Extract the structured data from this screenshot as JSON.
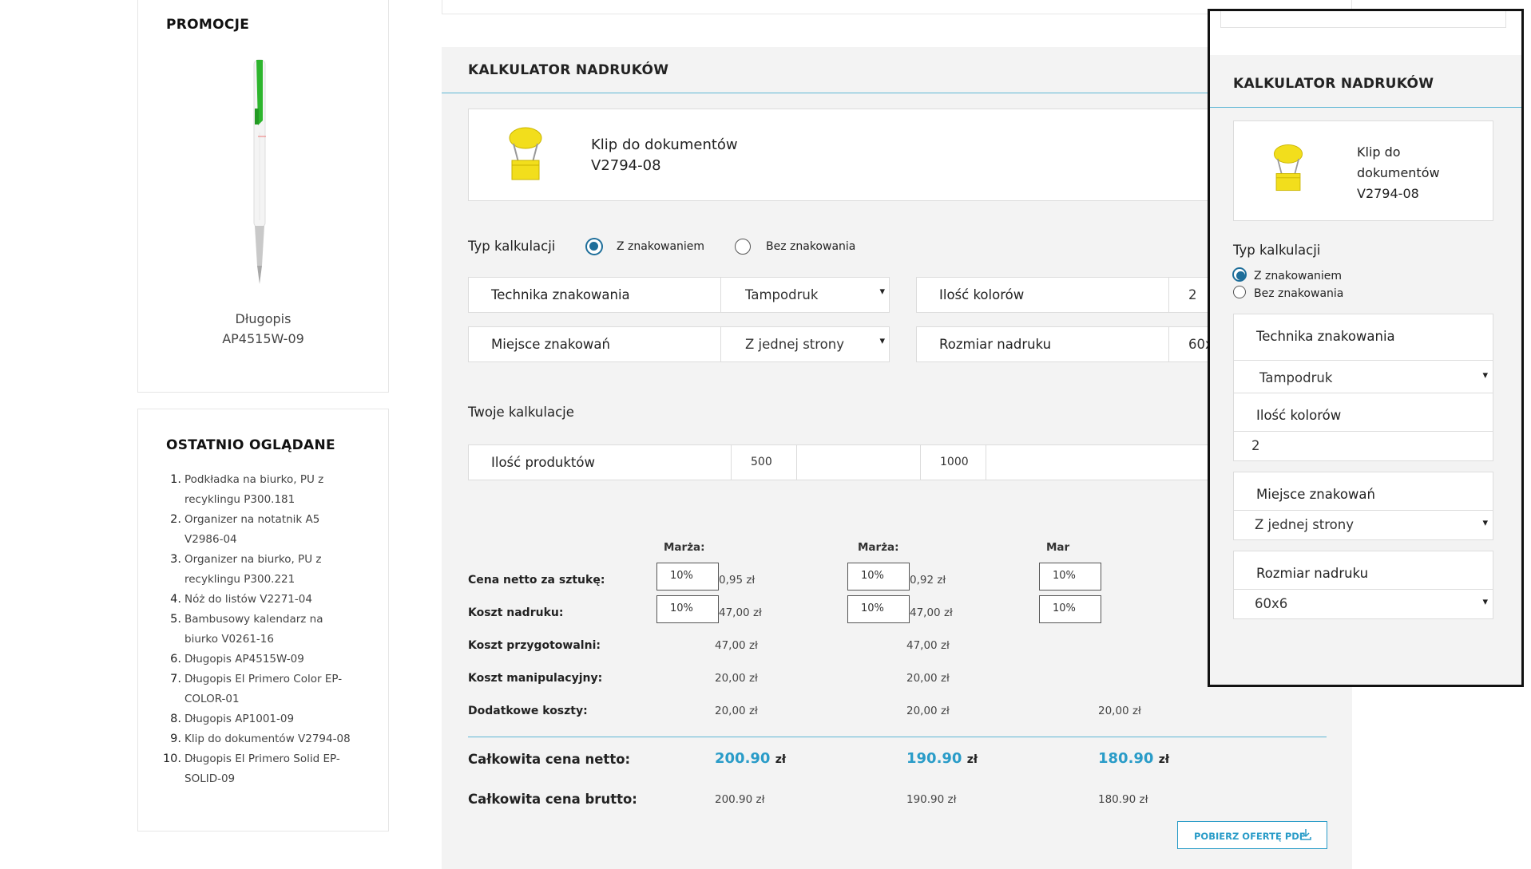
{
  "promo": {
    "title": "PROMOCJE",
    "product_name": "Długopis",
    "product_code": "AP4515W-09"
  },
  "recent": {
    "title": "OSTATNIO OGLĄDANE",
    "items": [
      {
        "num": "1.",
        "l1": "Podkładka na biurko, PU z",
        "l2": "recyklingu P300.181"
      },
      {
        "num": "2.",
        "l1": "Organizer na notatnik A5",
        "l2": "V2986-04"
      },
      {
        "num": "3.",
        "l1": "Organizer na biurko, PU z",
        "l2": "recyklingu P300.221"
      },
      {
        "num": "4.",
        "l1": "Nóż do listów V2271-04",
        "l2": ""
      },
      {
        "num": "5.",
        "l1": "Bambusowy kalendarz na",
        "l2": "biurko V0261-16"
      },
      {
        "num": "6.",
        "l1": "Długopis AP4515W-09",
        "l2": ""
      },
      {
        "num": "7.",
        "l1": "Długopis El Primero Color EP-",
        "l2": "COLOR-01"
      },
      {
        "num": "8.",
        "l1": "Długopis AP1001-09",
        "l2": ""
      },
      {
        "num": "9.",
        "l1": "Klip do dokumentów V2794-08",
        "l2": ""
      },
      {
        "num": "10.",
        "l1": "Długopis El Primero Solid EP-",
        "l2": "SOLID-09"
      }
    ]
  },
  "calc": {
    "title": "KALKULATOR NADRUKÓW",
    "product_name": "Klip do dokumentów",
    "product_code": "V2794-08",
    "typ_label": "Typ kalkulacji",
    "option_marked": "Z znakowaniem",
    "option_unmarked": "Bez znakowania",
    "selected_option": "Z znakowaniem",
    "technique_label": "Technika znakowania",
    "technique_value": "Tampodruk",
    "colors_label": "Ilość kolorów",
    "colors_value": "2",
    "place_label": "Miejsce znakowań",
    "place_value": "Z jednej strony",
    "size_label": "Rozmiar nadruku",
    "size_value_cut": "60x",
    "your_calcs": "Twoje kalkulacje",
    "qty_label": "Ilość produktów",
    "qty": [
      "500",
      "1000"
    ],
    "marza_label": "Marża:",
    "marza_label_cut": "Mar",
    "rows": {
      "unit_net": "Cena netto za sztukę:",
      "print_cost": "Koszt nadruku:",
      "prep_cost": "Koszt przygotowalni:",
      "handling_cost": "Koszt manipulacyjny:",
      "extra_cost": "Dodatkowe koszty:",
      "total_net": "Całkowita cena netto:",
      "total_gross": "Całkowita cena brutto:"
    },
    "columns": [
      {
        "unit_pct": "10%",
        "unit_net": "0,95 zł",
        "print_pct": "10%",
        "print_cost": "47,00 zł",
        "prep_cost": "47,00 zł",
        "handling_cost": "20,00 zł",
        "extra_cost": "20,00 zł",
        "total_net": "200.90",
        "total_gross": "200.90 zł"
      },
      {
        "unit_pct": "10%",
        "unit_net": "0,92 zł",
        "print_pct": "10%",
        "print_cost": "47,00 zł",
        "prep_cost": "47,00 zł",
        "handling_cost": "20,00 zł",
        "extra_cost": "20,00 zł",
        "total_net": "190.90",
        "total_gross": "190.90 zł"
      },
      {
        "unit_pct": "10%",
        "print_pct": "10%",
        "extra_cost": "20,00 zł",
        "total_net": "180.90",
        "total_gross": "180.90 zł"
      }
    ],
    "currency": "zł",
    "pdf_button": "POBIERZ OFERTĘ PDF"
  },
  "mobile": {
    "title": "KALKULATOR NADRUKÓW",
    "product_l1": "Klip do",
    "product_l2": "dokumentów",
    "product_code": "V2794-08",
    "typ_label": "Typ kalkulacji",
    "option_marked": "Z znakowaniem",
    "option_unmarked": "Bez znakowania",
    "technique_label": "Technika znakowania",
    "technique_value": "Tampodruk",
    "colors_label": "Ilość kolorów",
    "colors_value": "2",
    "place_label": "Miejsce znakowań",
    "place_value": "Z jednej strony",
    "size_label": "Rozmiar nadruku",
    "size_value": "60x6"
  },
  "colors": {
    "accent": "#2a9cc8",
    "divider": "#5db6d4",
    "radio": "#1e6e9a",
    "panel_bg": "#f3f3f3"
  }
}
